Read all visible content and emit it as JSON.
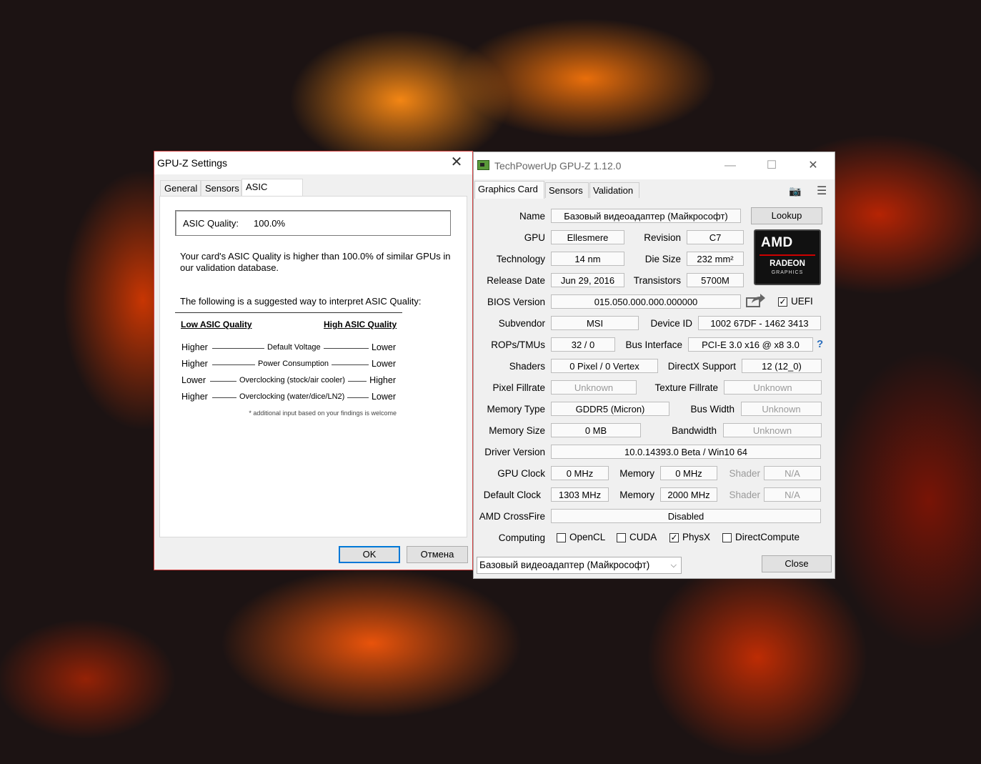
{
  "settings": {
    "title": "GPU-Z Settings",
    "close_glyph": "✕",
    "tabs": [
      "General",
      "Sensors",
      "ASIC Quality"
    ],
    "asic_label": "ASIC Quality:",
    "asic_value": "100.0%",
    "description": "Your card's ASIC Quality is higher than 100.0% of similar GPUs in our validation database.",
    "suggest_text": "The following is a suggested way to interpret ASIC Quality:",
    "low_head": "Low ASIC Quality",
    "high_head": "High ASIC Quality",
    "rows": [
      {
        "low": "Higher",
        "mid": "Default Voltage",
        "high": "Lower"
      },
      {
        "low": "Higher",
        "mid": "Power Consumption",
        "high": "Lower"
      },
      {
        "low": "Lower",
        "mid": "Overclocking (stock/air cooler)",
        "high": "Higher"
      },
      {
        "low": "Higher",
        "mid": "Overclocking (water/dice/LN2)",
        "high": "Lower"
      }
    ],
    "footnote": "* additional input based on your findings is welcome",
    "ok_label": "OK",
    "cancel_label": "Отмена"
  },
  "gpuz": {
    "title": "TechPowerUp GPU-Z 1.12.0",
    "minimize_glyph": "—",
    "maximize_glyph": "☐",
    "close_glyph": "✕",
    "tabs": [
      "Graphics Card",
      "Sensors",
      "Validation"
    ],
    "camera_glyph": "📷",
    "menu_glyph": "☰",
    "labels": {
      "name": "Name",
      "gpu": "GPU",
      "revision": "Revision",
      "technology": "Technology",
      "die_size": "Die Size",
      "release_date": "Release Date",
      "transistors": "Transistors",
      "bios_version": "BIOS Version",
      "subvendor": "Subvendor",
      "device_id": "Device ID",
      "rops_tmus": "ROPs/TMUs",
      "bus_interface": "Bus Interface",
      "shaders": "Shaders",
      "directx": "DirectX Support",
      "pixel_fillrate": "Pixel Fillrate",
      "texture_fillrate": "Texture Fillrate",
      "memory_type": "Memory Type",
      "bus_width": "Bus Width",
      "memory_size": "Memory Size",
      "bandwidth": "Bandwidth",
      "driver_version": "Driver Version",
      "gpu_clock": "GPU Clock",
      "memory": "Memory",
      "shader": "Shader",
      "default_clock": "Default Clock",
      "crossfire": "AMD CrossFire",
      "computing": "Computing"
    },
    "values": {
      "name": "Базовый видеоадаптер (Майкрософт)",
      "gpu": "Ellesmere",
      "revision": "C7",
      "technology": "14 nm",
      "die_size": "232 mm²",
      "release_date": "Jun 29, 2016",
      "transistors": "5700M",
      "bios_version": "015.050.000.000.000000",
      "subvendor": "MSI",
      "device_id": "1002 67DF - 1462 3413",
      "rops_tmus": "32 / 0",
      "bus_interface": "PCI-E 3.0 x16 @ x8 3.0",
      "shaders": "0 Pixel / 0 Vertex",
      "directx": "12 (12_0)",
      "pixel_fillrate": "Unknown",
      "texture_fillrate": "Unknown",
      "memory_type": "GDDR5 (Micron)",
      "bus_width": "Unknown",
      "memory_size": "0 MB",
      "bandwidth": "Unknown",
      "driver_version": "10.0.14393.0 Beta / Win10 64",
      "gpu_clock": "0 MHz",
      "gpu_memory": "0 MHz",
      "gpu_shader": "N/A",
      "default_clock": "1303 MHz",
      "default_memory": "2000 MHz",
      "default_shader": "N/A",
      "crossfire": "Disabled"
    },
    "lookup_label": "Lookup",
    "uefi_label": "UEFI",
    "uefi_checked": true,
    "bus_help": "?",
    "computing": [
      {
        "label": "OpenCL",
        "checked": false
      },
      {
        "label": "CUDA",
        "checked": false
      },
      {
        "label": "PhysX",
        "checked": true
      },
      {
        "label": "DirectCompute",
        "checked": false
      }
    ],
    "amd_logo": {
      "brand": "AMD",
      "line1": "RADEON",
      "line2": "GRAPHICS"
    },
    "device_select": "Базовый видеоадаптер (Майкрософт)",
    "close_label": "Close"
  }
}
